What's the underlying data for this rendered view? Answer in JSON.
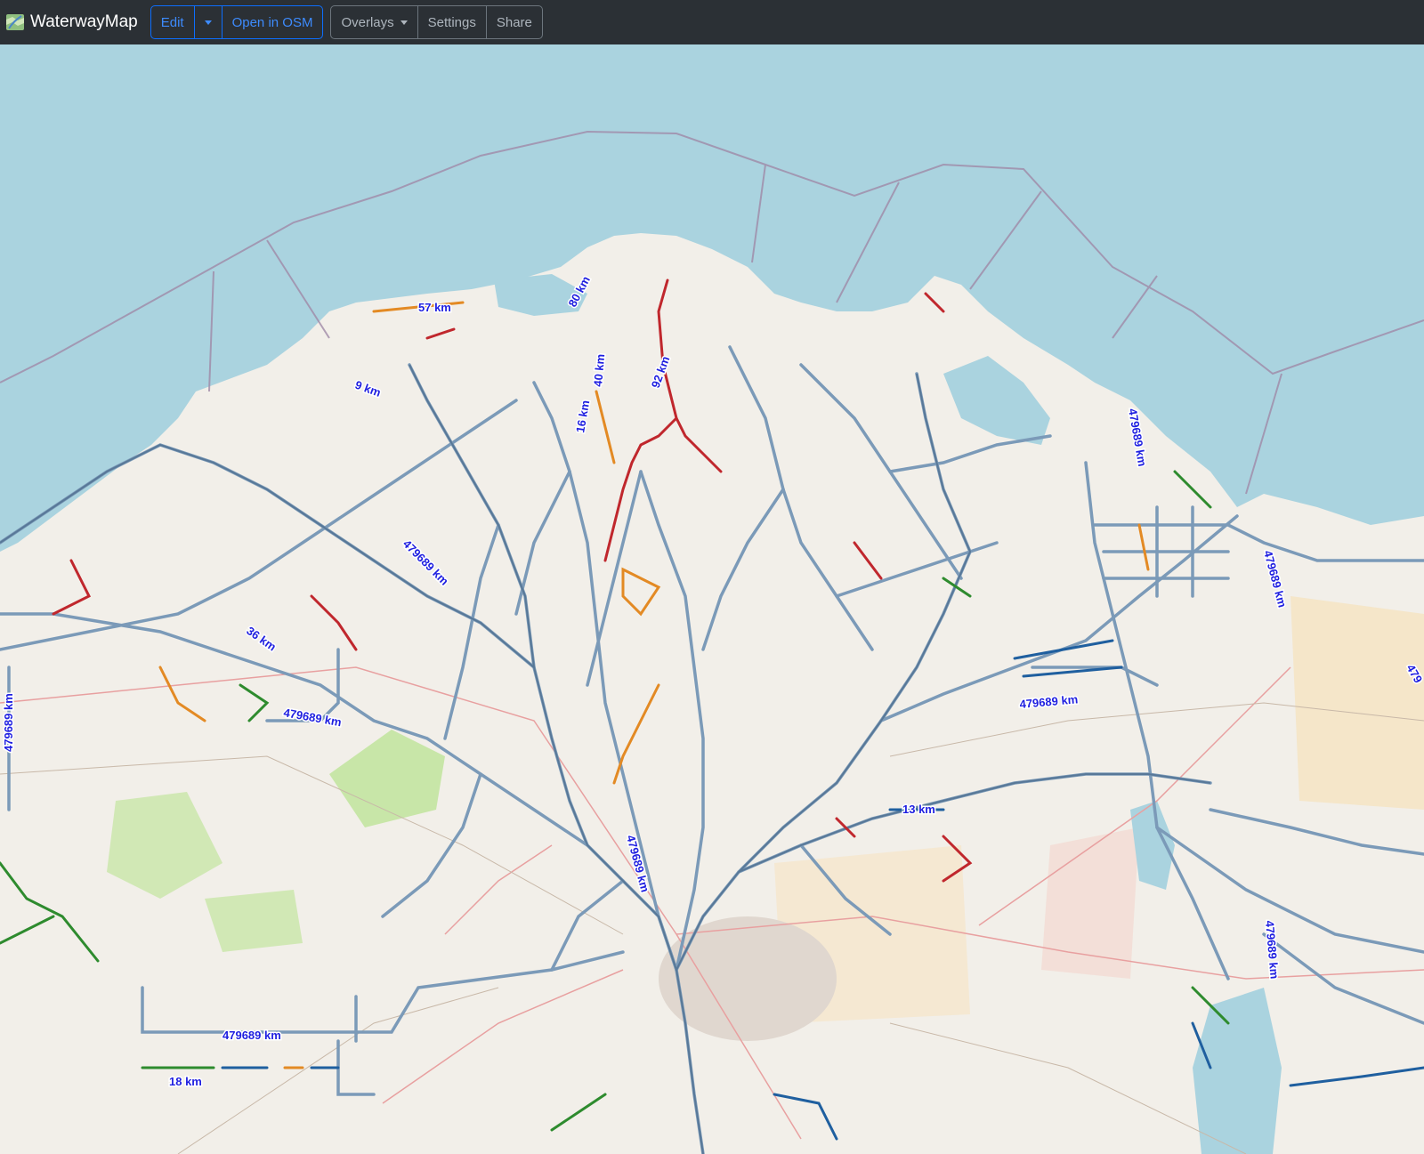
{
  "navbar": {
    "brand": "WaterwayMap",
    "edit_button": {
      "label": "Edit"
    },
    "open_osm_button": {
      "label": "Open in OSM"
    },
    "overlays_button": {
      "label": "Overlays"
    },
    "settings_button": {
      "label": "Settings"
    },
    "share_button": {
      "label": "Share"
    }
  },
  "colors": {
    "navbar_bg": "#2b3035",
    "primary": "#0d6efd",
    "sea": "#aad3df",
    "land": "#f2efe9",
    "waterway": "#7b9ab8",
    "waterway_dark": "#4a6a8a"
  },
  "map": {
    "labels": [
      {
        "text": "57 km"
      },
      {
        "text": "80 km"
      },
      {
        "text": "92 km"
      },
      {
        "text": "16 km"
      },
      {
        "text": "40 km"
      },
      {
        "text": "9 km"
      },
      {
        "text": "479689 km"
      },
      {
        "text": "36 km"
      },
      {
        "text": "479689 km"
      },
      {
        "text": "479689 km"
      },
      {
        "text": "479689 km"
      },
      {
        "text": "13 km"
      },
      {
        "text": "479689 km"
      },
      {
        "text": "18 km"
      },
      {
        "text": "479689 km"
      },
      {
        "text": "479689 km"
      },
      {
        "text": "479689 km"
      },
      {
        "text": "479689 km"
      },
      {
        "text": "479"
      }
    ]
  }
}
